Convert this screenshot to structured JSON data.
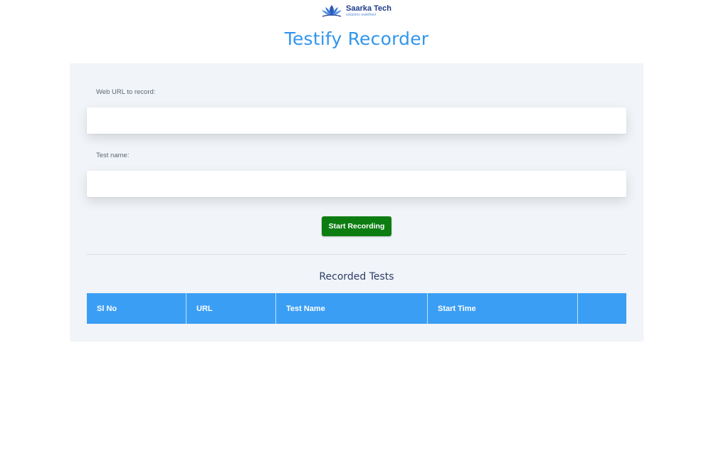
{
  "logo": {
    "name": "Saarka Tech",
    "tagline": "solutions redefined",
    "brand_color": "#1f3c8c"
  },
  "title": "Testify Recorder",
  "form": {
    "url_label": "Web URL to record:",
    "url_value": "",
    "name_label": "Test name:",
    "name_value": "",
    "start_button_label": "Start Recording"
  },
  "recorded_tests": {
    "heading": "Recorded Tests",
    "columns": [
      "Sl No",
      "URL",
      "Test Name",
      "Start Time",
      ""
    ],
    "rows": []
  },
  "colors": {
    "accent": "#3296ec",
    "table_header": "#3b9ef5",
    "start_button": "#0d7d12",
    "card_background": "#f1f4f8"
  }
}
